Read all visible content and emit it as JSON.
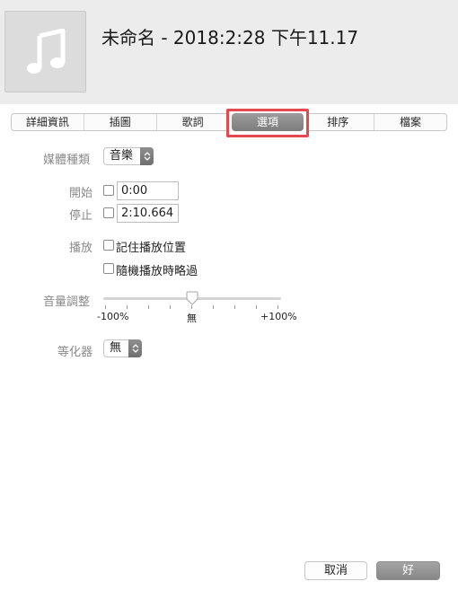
{
  "header": {
    "title": "未命名 - 2018:2:28 下午11.17",
    "artwork_icon": "music-note-icon"
  },
  "tabs": [
    {
      "label": "詳細資訊",
      "active": false
    },
    {
      "label": "插圖",
      "active": false
    },
    {
      "label": "歌詞",
      "active": false
    },
    {
      "label": "選項",
      "active": true
    },
    {
      "label": "排序",
      "active": false
    },
    {
      "label": "檔案",
      "active": false
    }
  ],
  "options": {
    "media_kind_label": "媒體種類",
    "media_kind_value": "音樂",
    "start_label": "開始",
    "start_checked": false,
    "start_value": "0:00",
    "stop_label": "停止",
    "stop_checked": false,
    "stop_value": "2:10.664",
    "playback_label": "播放",
    "remember_position_label": "記住播放位置",
    "remember_position_checked": false,
    "skip_shuffle_label": "隨機播放時略過",
    "skip_shuffle_checked": false,
    "volume_label": "音量調整",
    "volume_min": "-100%",
    "volume_mid": "無",
    "volume_max": "+100%",
    "volume_value_percent": 0,
    "eq_label": "等化器",
    "eq_value": "無"
  },
  "buttons": {
    "cancel": "取消",
    "ok": "好"
  },
  "colors": {
    "highlight": "#e5484f",
    "header_bg": "#ececec"
  }
}
